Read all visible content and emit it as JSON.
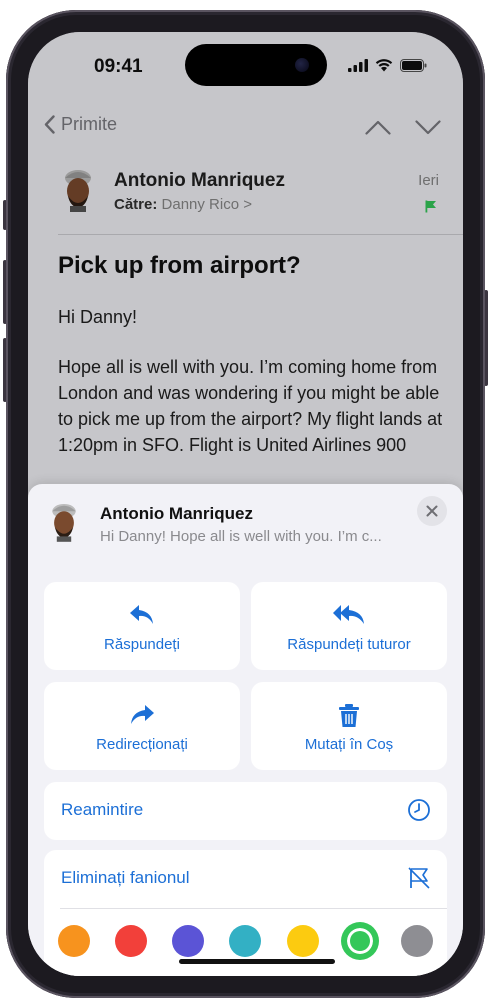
{
  "status": {
    "time": "09:41"
  },
  "nav": {
    "back_label": "Primite"
  },
  "email": {
    "sender": "Antonio Manriquez",
    "to_label": "Către:",
    "recipient": "Danny Rico >",
    "date": "Ieri",
    "subject": "Pick up from airport?",
    "greeting": "Hi Danny!",
    "body": "Hope all is well with you. I’m coming home from London and was wondering if you might be able to pick me up from the airport? My flight lands at 1:20pm in SFO. Flight is United Airlines 900"
  },
  "sheet": {
    "sender": "Antonio Manriquez",
    "preview": "Hi Danny! Hope all is well with you. I’m c...",
    "actions": {
      "reply": "Răspundeți",
      "reply_all": "Răspundeți tuturor",
      "forward": "Redirecționați",
      "trash": "Mutați în Coș"
    },
    "remind": "Reamintire",
    "unflag": "Eliminați fanionul",
    "flag_colors": [
      {
        "name": "orange",
        "hex": "#f7931e"
      },
      {
        "name": "red",
        "hex": "#f2403a"
      },
      {
        "name": "purple",
        "hex": "#5b54d6"
      },
      {
        "name": "teal",
        "hex": "#33b0c4"
      },
      {
        "name": "yellow",
        "hex": "#fccb10"
      },
      {
        "name": "green",
        "hex": "#34c759",
        "selected": true
      },
      {
        "name": "gray",
        "hex": "#8e8e93"
      }
    ]
  },
  "colors": {
    "accent": "#1c6fd6",
    "flag_green": "#34c759"
  }
}
